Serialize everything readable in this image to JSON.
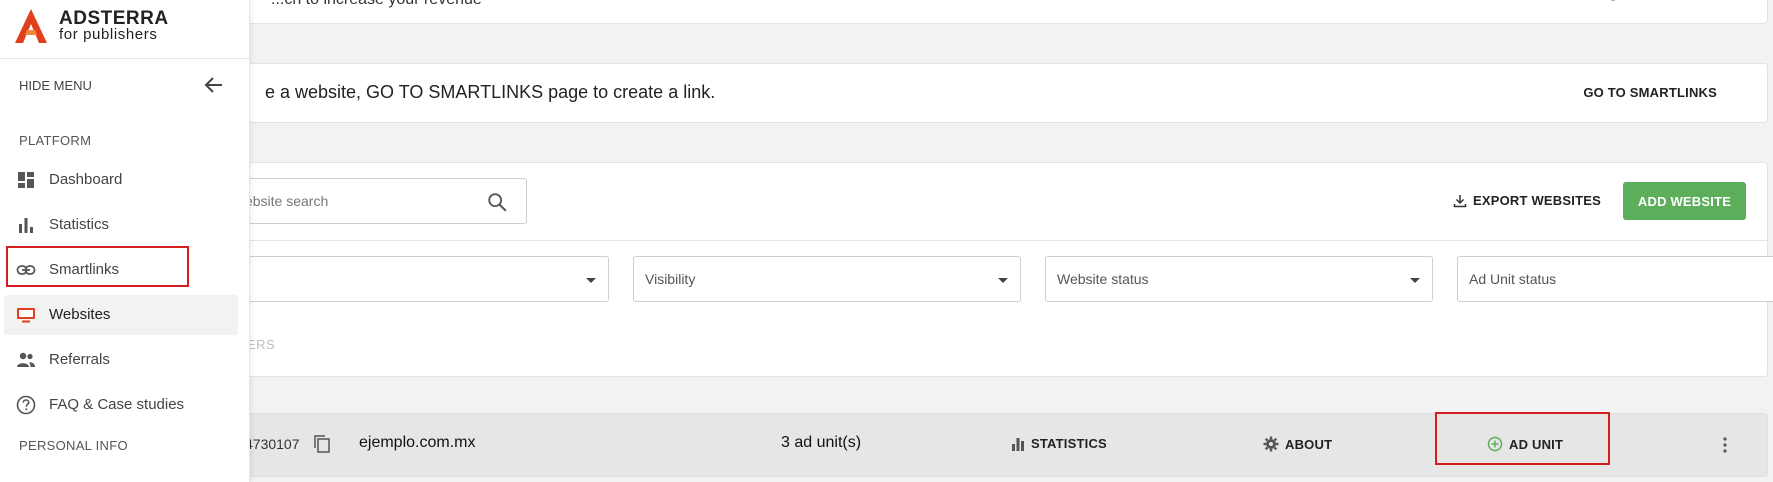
{
  "sidebar": {
    "brand": "ADSTERRA",
    "brand_sub": "for publishers",
    "hide_menu": "HIDE MENU",
    "section_platform": "PLATFORM",
    "items": [
      {
        "label": "Dashboard",
        "icon": "dashboard-icon"
      },
      {
        "label": "Statistics",
        "icon": "bar-chart-icon"
      },
      {
        "label": "Smartlinks",
        "icon": "link-icon"
      },
      {
        "label": "Websites",
        "icon": "monitor-icon"
      },
      {
        "label": "Referrals",
        "icon": "people-icon"
      },
      {
        "label": "FAQ & Case studies",
        "icon": "help-icon"
      }
    ],
    "section_personal": "PERSONAL INFO",
    "active_item": "Websites"
  },
  "top_strip": {
    "text": "...ch to increase your revenue"
  },
  "info_banner": {
    "text": "e a website, GO TO SMARTLINKS page to create a link.",
    "button": "GO TO SMARTLINKS"
  },
  "toolbar": {
    "search_placeholder": "Website search",
    "export_label": "EXPORT WEBSITES",
    "add_label": "ADD WEBSITE"
  },
  "filters": {
    "selects": [
      "",
      "Visibility",
      "Website status",
      "Ad Unit status"
    ],
    "clear_label": "ERS"
  },
  "website_row": {
    "id": "4730107",
    "domain": "ejemplo.com.mx",
    "units": "3 ad unit(s)",
    "statistics_label": "STATISTICS",
    "about_label": "ABOUT",
    "ad_unit_label": "AD UNIT"
  },
  "colors": {
    "brand_red": "#e2401c",
    "accent_green": "#5cae5b",
    "highlight_red": "#d61d1d"
  }
}
